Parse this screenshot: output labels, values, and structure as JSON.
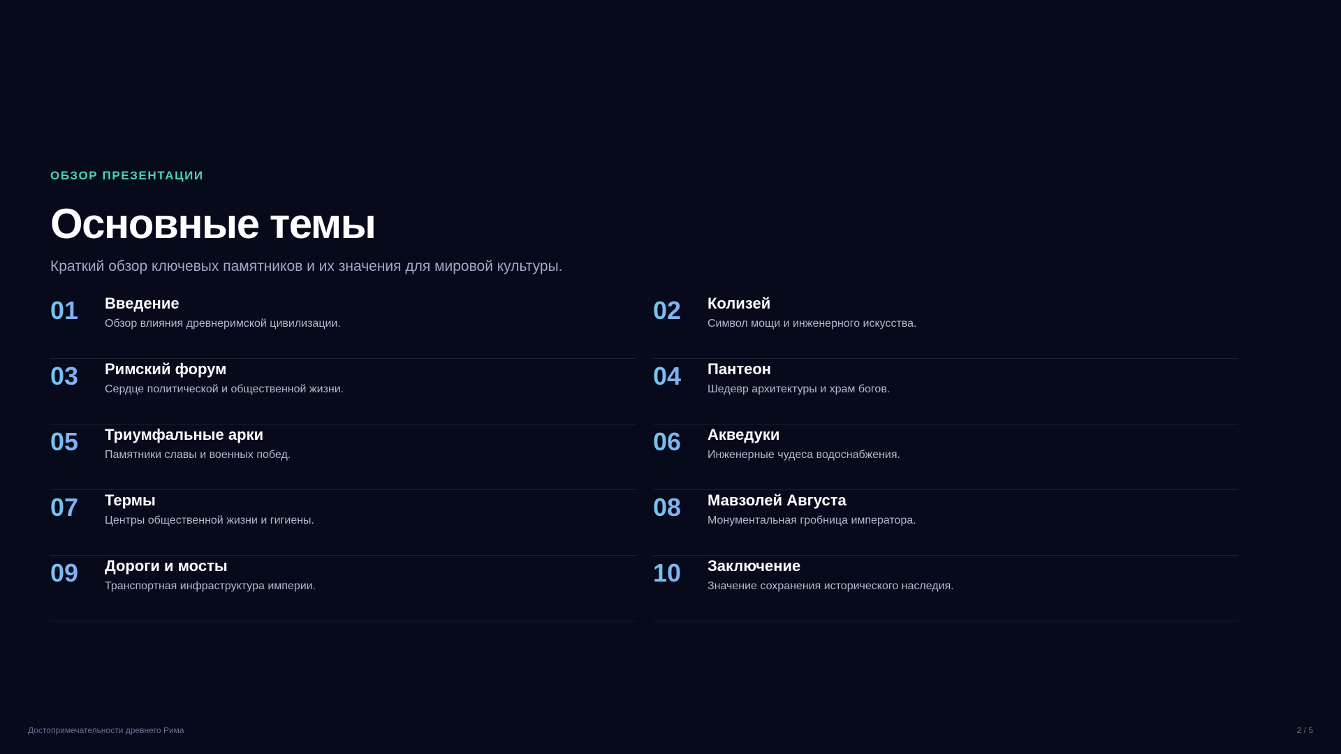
{
  "slide": {
    "eyebrow": "ОБЗОР ПРЕЗЕНТАЦИИ",
    "title": "Основные темы",
    "subtitle": "Краткий обзор ключевых памятников и их значения для мировой культуры.",
    "items": [
      {
        "num": "01",
        "title": "Введение",
        "desc": "Обзор влияния древнеримской цивилизации."
      },
      {
        "num": "02",
        "title": "Колизей",
        "desc": "Символ мощи и инженерного искусства."
      },
      {
        "num": "03",
        "title": "Римский форум",
        "desc": "Сердце политической и общественной жизни."
      },
      {
        "num": "04",
        "title": "Пантеон",
        "desc": "Шедевр архитектуры и храм богов."
      },
      {
        "num": "05",
        "title": "Триумфальные арки",
        "desc": "Памятники славы и военных побед."
      },
      {
        "num": "06",
        "title": "Акведуки",
        "desc": "Инженерные чудеса водоснабжения."
      },
      {
        "num": "07",
        "title": "Термы",
        "desc": "Центры общественной жизни и гигиены."
      },
      {
        "num": "08",
        "title": "Мавзолей Августа",
        "desc": "Монументальная гробница императора."
      },
      {
        "num": "09",
        "title": "Дороги и мосты",
        "desc": "Транспортная инфраструктура империи."
      },
      {
        "num": "10",
        "title": "Заключение",
        "desc": "Значение сохранения исторического наследия."
      }
    ]
  },
  "footer": {
    "presentation_title": "Достопримечательности древнего Рима",
    "page_indicator": "2 / 5"
  },
  "colors": {
    "background": "#060a1b",
    "accent": "#45d7b4",
    "number_gradient_start": "#74c7f0",
    "number_gradient_end": "#a08df0"
  }
}
